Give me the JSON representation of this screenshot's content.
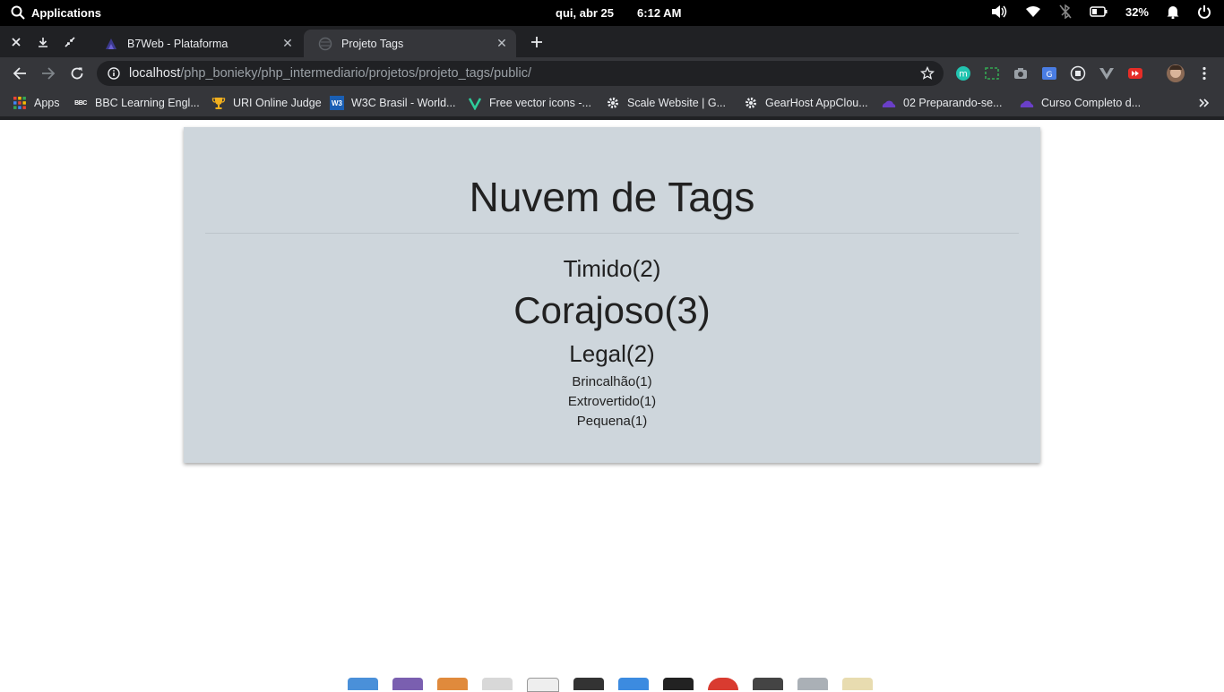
{
  "os_bar": {
    "applications_label": "Applications",
    "date": "qui, abr 25",
    "time": "6:12 AM",
    "battery_percent": "32%"
  },
  "tabs": [
    {
      "title": "B7Web - Plataforma",
      "active": false
    },
    {
      "title": "Projeto Tags",
      "active": true
    }
  ],
  "address_bar": {
    "host": "localhost",
    "path": "/php_bonieky/php_intermediario/projetos/projeto_tags/public/"
  },
  "bookmarks": [
    {
      "label": "Apps",
      "icon": "apps-grid-icon"
    },
    {
      "label": "BBC Learning Engl...",
      "icon": "bbc-icon"
    },
    {
      "label": "URI Online Judge",
      "icon": "trophy-icon"
    },
    {
      "label": "W3C Brasil - World...",
      "icon": "w3c-icon"
    },
    {
      "label": "Free vector icons -...",
      "icon": "vector-icon"
    },
    {
      "label": "Scale Website | G...",
      "icon": "gear-icon"
    },
    {
      "label": "GearHost AppClou...",
      "icon": "gear-icon"
    },
    {
      "label": "02 Preparando-se...",
      "icon": "cloud-icon"
    },
    {
      "label": "Curso Completo d...",
      "icon": "cloud-icon"
    }
  ],
  "page": {
    "heading": "Nuvem de Tags",
    "tags": [
      {
        "label": "Timido(2)",
        "weight": 2
      },
      {
        "label": "Corajoso(3)",
        "weight": 3
      },
      {
        "label": "Legal(2)",
        "weight": 2
      },
      {
        "label": "Brincalhão(1)",
        "weight": 1
      },
      {
        "label": "Extrovertido(1)",
        "weight": 1
      },
      {
        "label": "Pequena(1)",
        "weight": 1
      }
    ]
  },
  "colors": {
    "card_background": "#ced6dc",
    "text": "#212121",
    "browser_frame": "#202124",
    "toolbar": "#35363a"
  }
}
